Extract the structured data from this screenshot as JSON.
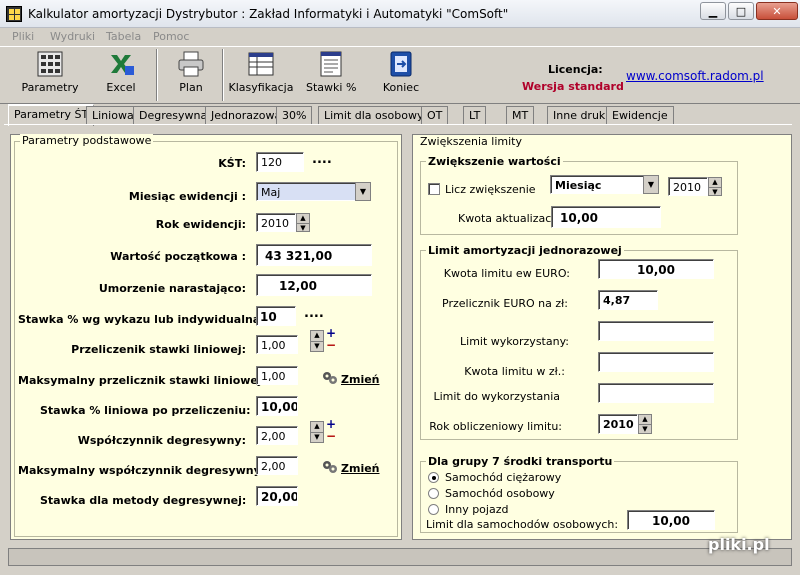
{
  "window": {
    "title": "Kalkulator amortyzacji   Dystrybutor : Zakład Informatyki i Automatyki \"ComSoft\""
  },
  "menu": [
    "Pliki",
    "Wydruki",
    "Tabela",
    "Pomoc"
  ],
  "toolbar": {
    "buttons": [
      "Parametry",
      "Excel",
      "Plan",
      "Klasyfikacja",
      "Stawki %",
      "Koniec"
    ],
    "license_title": "Licencja:",
    "license_value": "Wersja standard",
    "website": "www.comsoft.radom.pl"
  },
  "tabs": [
    "Parametry ŚT",
    "Liniowa",
    "Degresywna",
    "Jednorazowa",
    "30%",
    "Limit dla osobowych",
    "OT",
    "LT",
    "MT",
    "Inne druki",
    "Ewidencje"
  ],
  "left": {
    "title": "Parametry podstawowe",
    "kst_label": "KŚT:",
    "kst_value": "120",
    "kst_dots": "....",
    "month_label": "Miesiąc ewidencji :",
    "month_value": "Maj",
    "year_label": "Rok ewidencji:",
    "year_value": "2010",
    "initial_value_label": "Wartość początkowa :",
    "initial_value": "43 321,00",
    "depreciation_label": "Umorzenie narastająco:",
    "depreciation_value": "12,00",
    "rate_label": "Stawka % wg  wykazu lub indywidualna:",
    "rate_value": "10",
    "rate_dots": "....",
    "linear_factor_label": "Przeliczenik  stawki liniowej:",
    "linear_factor_value": "1,00",
    "max_linear_label": "Maksymalny przelicznik stawki  liniowej:",
    "max_linear_value": "1,00",
    "change_label": "Zmień",
    "linear_after_label": "Stawka % liniowa po przeliczeniu:",
    "linear_after_value": "10,00",
    "degressive_label": "Współczynnik degresywny:",
    "degressive_value": "2,00",
    "max_degressive_label": "Maksymalny współczynnik degresywny :",
    "max_degressive_value": "2,00",
    "change_label2": "Zmień",
    "degressive_rate_label": "Stawka dla metody degresywnej:",
    "degressive_rate_value": "20,00"
  },
  "right": {
    "title": "Zwiększenia limity",
    "increase": {
      "title": "Zwiększenie wartości",
      "checkbox_label": "Licz zwiększenie",
      "period_value": "Miesiąc",
      "year_value": "2010",
      "amount_label": "Kwota aktualizacji",
      "amount_value": "10,00"
    },
    "limit": {
      "title": "Limit amortyzacji jednorazowej",
      "euro_limit_label": "Kwota limitu ew EURO:",
      "euro_limit_value": "10,00",
      "euro_rate_label": "Przelicznik EURO na zł:",
      "euro_rate_value": "4,87",
      "used_label": "Limit wykorzystany:",
      "used_value": "",
      "pln_limit_label": "Kwota limitu w zł.:",
      "pln_limit_value": "",
      "remaining_label": "Limit do wykorzystania",
      "remaining_value": "",
      "year_label": "Rok obliczeniowy limitu:",
      "year_value": "2010"
    },
    "transport": {
      "title": "Dla grupy 7 środki transportu",
      "options": [
        "Samochód ciężarowy",
        "Samochód osobowy",
        "Inny pojazd"
      ],
      "selected": "Samochód ciężarowy",
      "car_limit_label": "Limit dla samochodów  osobowych:",
      "car_limit_value": "10,00"
    }
  },
  "watermark": "pliki.pl"
}
